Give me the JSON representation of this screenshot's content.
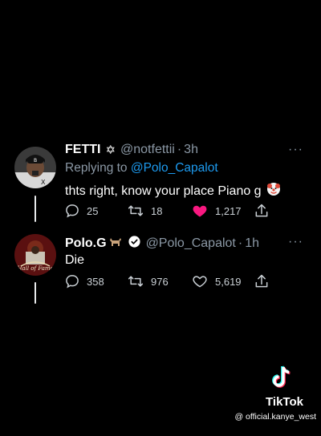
{
  "tweets": [
    {
      "name": "FETTI",
      "name_badge": "✡",
      "handle": "@notfettii",
      "separator": "·",
      "time": "3h",
      "more": "···",
      "reply_prefix": "Replying to",
      "reply_to": "@Polo_Capalot",
      "text": "thts right, know your place Piano g",
      "text_emoji": "clown-face",
      "replies": "25",
      "retweets": "18",
      "likes": "1,217",
      "liked": true,
      "like_color": "#f91880"
    },
    {
      "name": "Polo.G",
      "name_badge": "goat",
      "handle": "@Polo_Capalot",
      "separator": "·",
      "time": "1h",
      "more": "···",
      "text": "Die",
      "replies": "358",
      "retweets": "976",
      "likes": "5,619",
      "liked": false,
      "verified": true
    }
  ],
  "watermark": {
    "brand": "TikTok",
    "handle": "@ official.kanye_west"
  },
  "colors": {
    "background": "#000000",
    "text": "#e7e9ea",
    "muted": "#8b98a5",
    "link": "#1d9bf0",
    "like": "#f91880"
  }
}
